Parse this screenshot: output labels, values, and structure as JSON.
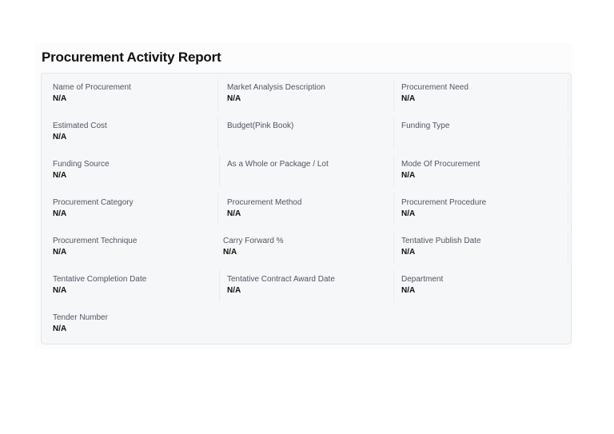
{
  "report": {
    "title": "Procurement Activity Report"
  },
  "fields": {
    "name_of_procurement": {
      "label": "Name of Procurement",
      "value": "N/A"
    },
    "market_analysis_description": {
      "label": "Market Analysis Description",
      "value": "N/A"
    },
    "procurement_need": {
      "label": "Procurement Need",
      "value": "N/A"
    },
    "estimated_cost": {
      "label": "Estimated Cost",
      "value": "N/A"
    },
    "budget_pink_book": {
      "label": "Budget(Pink Book)",
      "value": ""
    },
    "funding_type": {
      "label": "Funding Type",
      "value": ""
    },
    "funding_source": {
      "label": "Funding Source",
      "value": "N/A"
    },
    "whole_or_package_lot": {
      "label": "As a Whole or Package / Lot",
      "value": ""
    },
    "mode_of_procurement": {
      "label": "Mode Of Procurement",
      "value": "N/A"
    },
    "procurement_category": {
      "label": "Procurement Category",
      "value": "N/A"
    },
    "procurement_method": {
      "label": "Procurement Method",
      "value": "N/A"
    },
    "procurement_procedure": {
      "label": "Procurement Procedure",
      "value": "N/A"
    },
    "procurement_technique": {
      "label": "Procurement Technique",
      "value": "N/A"
    },
    "carry_forward_percent": {
      "label": "Carry Forward %",
      "value": "N/A"
    },
    "tentative_publish_date": {
      "label": "Tentative Publish Date",
      "value": "N/A"
    },
    "tentative_completion_date": {
      "label": "Tentative Completion Date",
      "value": "N/A"
    },
    "tentative_contract_award_date": {
      "label": "Tentative Contract Award Date",
      "value": "N/A"
    },
    "department": {
      "label": "Department",
      "value": "N/A"
    },
    "tender_number": {
      "label": "Tender Number",
      "value": "N/A"
    }
  }
}
